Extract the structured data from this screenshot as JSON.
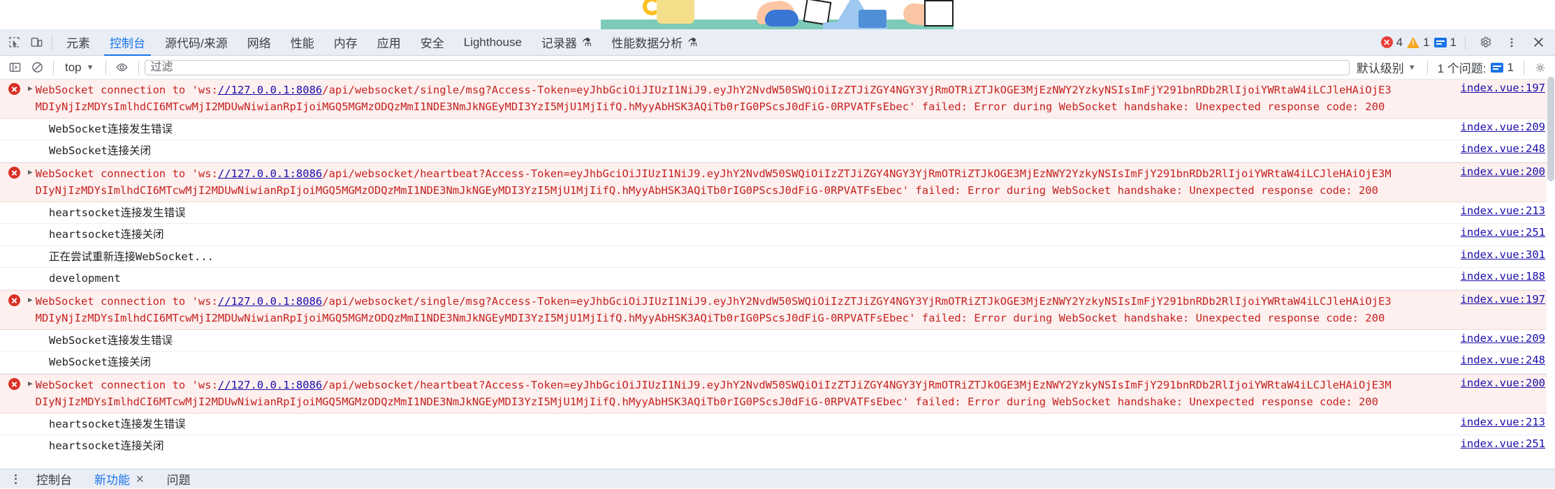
{
  "tabbar": {
    "inspect_icon": "inspect-element-icon",
    "device_icon": "device-toolbar-icon",
    "tabs": [
      {
        "label": "元素",
        "active": false
      },
      {
        "label": "控制台",
        "active": true
      },
      {
        "label": "源代码/来源",
        "active": false
      },
      {
        "label": "网络",
        "active": false
      },
      {
        "label": "性能",
        "active": false
      },
      {
        "label": "内存",
        "active": false
      },
      {
        "label": "应用",
        "active": false
      },
      {
        "label": "安全",
        "active": false
      },
      {
        "label": "Lighthouse",
        "active": false
      },
      {
        "label": "记录器",
        "active": false,
        "suffix": "⚗"
      },
      {
        "label": "性能数据分析",
        "active": false,
        "suffix": "⚗"
      }
    ],
    "status": {
      "error_count": "4",
      "warning_count": "1",
      "info_count": "1",
      "settings_icon": "gear-icon",
      "more_icon": "kebab-menu-icon",
      "close_icon": "close-icon"
    }
  },
  "console_toolbar": {
    "sidebar_icon": "console-sidebar-icon",
    "clear_icon": "clear-console-icon",
    "context": "top",
    "eye_icon": "live-expression-icon",
    "filter_placeholder": "过滤",
    "filter_value": "",
    "level": "默认级别",
    "issues_label": "1 个问题:",
    "issues_count": "1",
    "settings_icon": "gear-icon"
  },
  "messages": [
    {
      "type": "error",
      "clipped": true,
      "prefix": "WebSocket connection to 'ws:",
      "url": "//127.0.0.1:8086",
      "suffix": "/api/websocket/single/msg?Access-Token=eyJhbGciOiJIUzI1NiJ9.eyJhY2NvdW50SWQiOiIzZTJiZGY4NGY3YjRmOTRiZTJkOGE3MjEzNWY2YzkyNSIsImFjY291bnRDb2RlIjoiYWRtaW4iLCJleHAiOjE3MDIyNjIzMDYsImlhdCI6MTcwMjI2MDUwNiwianRpIjoiMGQ5MGMzODQzMmI1NDE3NmJkNGEyMDI3YzI5MjU1MjIifQ.hMyyAbHSK3AQiTb0rIG0PScsJ0dFiG-0RPVATFsEbec' failed: Error during WebSocket handshake: Unexpected response code: 200",
      "source": "index.vue:197"
    },
    {
      "type": "log",
      "text": "WebSocket连接发生错误",
      "source": "index.vue:209"
    },
    {
      "type": "log",
      "text": "WebSocket连接关闭",
      "source": "index.vue:248"
    },
    {
      "type": "error",
      "prefix": "WebSocket connection to 'ws:",
      "url": "//127.0.0.1:8086",
      "suffix": "/api/websocket/heartbeat?Access-Token=eyJhbGciOiJIUzI1NiJ9.eyJhY2NvdW50SWQiOiIzZTJiZGY4NGY3YjRmOTRiZTJkOGE3MjEzNWY2YzkyNSIsImFjY291bnRDb2RlIjoiYWRtaW4iLCJleHAiOjE3MDIyNjIzMDYsImlhdCI6MTcwMjI2MDUwNiwianRpIjoiMGQ5MGMzODQzMmI1NDE3NmJkNGEyMDI3YzI5MjU1MjIifQ.hMyyAbHSK3AQiTb0rIG0PScsJ0dFiG-0RPVATFsEbec' failed: Error during WebSocket handshake: Unexpected response code: 200",
      "source": "index.vue:200"
    },
    {
      "type": "log",
      "text": "heartsocket连接发生错误",
      "source": "index.vue:213"
    },
    {
      "type": "log",
      "text": "heartsocket连接关闭",
      "source": "index.vue:251"
    },
    {
      "type": "log",
      "text": "正在尝试重新连接WebSocket...",
      "source": "index.vue:301"
    },
    {
      "type": "log",
      "text": "development",
      "source": "index.vue:188"
    },
    {
      "type": "error",
      "prefix": "WebSocket connection to 'ws:",
      "url": "//127.0.0.1:8086",
      "suffix": "/api/websocket/single/msg?Access-Token=eyJhbGciOiJIUzI1NiJ9.eyJhY2NvdW50SWQiOiIzZTJiZGY4NGY3YjRmOTRiZTJkOGE3MjEzNWY2YzkyNSIsImFjY291bnRDb2RlIjoiYWRtaW4iLCJleHAiOjE3MDIyNjIzMDYsImlhdCI6MTcwMjI2MDUwNiwianRpIjoiMGQ5MGMzODQzMmI1NDE3NmJkNGEyMDI3YzI5MjU1MjIifQ.hMyyAbHSK3AQiTb0rIG0PScsJ0dFiG-0RPVATFsEbec' failed: Error during WebSocket handshake: Unexpected response code: 200",
      "source": "index.vue:197"
    },
    {
      "type": "log",
      "text": "WebSocket连接发生错误",
      "source": "index.vue:209"
    },
    {
      "type": "log",
      "text": "WebSocket连接关闭",
      "source": "index.vue:248"
    },
    {
      "type": "error",
      "prefix": "WebSocket connection to 'ws:",
      "url": "//127.0.0.1:8086",
      "suffix": "/api/websocket/heartbeat?Access-Token=eyJhbGciOiJIUzI1NiJ9.eyJhY2NvdW50SWQiOiIzZTJiZGY4NGY3YjRmOTRiZTJkOGE3MjEzNWY2YzkyNSIsImFjY291bnRDb2RlIjoiYWRtaW4iLCJleHAiOjE3MDIyNjIzMDYsImlhdCI6MTcwMjI2MDUwNiwianRpIjoiMGQ5MGMzODQzMmI1NDE3NmJkNGEyMDI3YzI5MjU1MjIifQ.hMyyAbHSK3AQiTb0rIG0PScsJ0dFiG-0RPVATFsEbec' failed: Error during WebSocket handshake: Unexpected response code: 200",
      "source": "index.vue:200"
    },
    {
      "type": "log",
      "text": "heartsocket连接发生错误",
      "source": "index.vue:213"
    },
    {
      "type": "log",
      "text": "heartsocket连接关闭",
      "source": "index.vue:251"
    }
  ],
  "prompt": ">",
  "drawer": {
    "more_icon": "kebab-menu-icon",
    "tabs": [
      {
        "label": "控制台",
        "active": false,
        "closable": false
      },
      {
        "label": "新功能",
        "active": true,
        "closable": true
      },
      {
        "label": "问题",
        "active": false,
        "closable": false
      }
    ]
  },
  "colors": {
    "accent": "#1a73e8",
    "error": "#d93025",
    "error_text": "#c5221f",
    "error_bg": "#fdf0ef",
    "link": "#1a0dab",
    "toolbar_bg": "#e9eef6"
  }
}
